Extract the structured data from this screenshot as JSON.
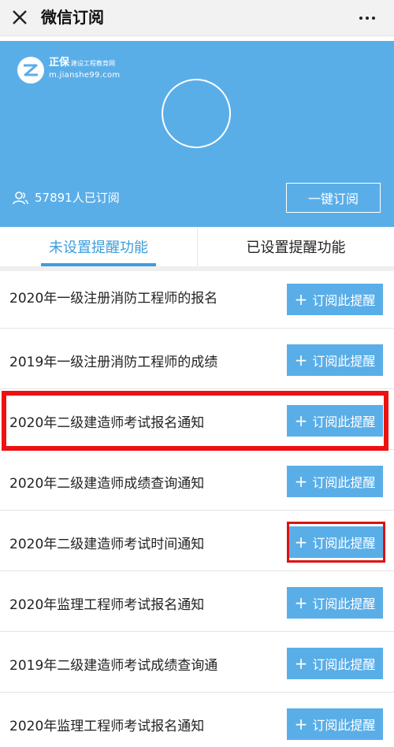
{
  "header": {
    "title": "微信订阅",
    "close_icon": "close-icon",
    "more_icon": "more-dots-icon"
  },
  "hero": {
    "logo_name": "正保",
    "logo_tagline": "建设工程教育网",
    "logo_url": "m.jianshe99.com",
    "subscriber_text": "57891人已订阅",
    "one_click_label": "一键订阅",
    "background_color": "#5aaee8"
  },
  "tabs": [
    {
      "label": "未设置提醒功能",
      "active": true
    },
    {
      "label": "已设置提醒功能",
      "active": false
    }
  ],
  "subscribe_button_label": "订阅此提醒",
  "items": [
    {
      "title": "2020年一级注册消防工程师的报名"
    },
    {
      "title": "2019年一级注册消防工程师的成绩"
    },
    {
      "title": "2020年二级建造师考试报名通知"
    },
    {
      "title": "2020年二级建造师成绩查询通知"
    },
    {
      "title": "2020年二级建造师考试时间通知"
    },
    {
      "title": "2020年监理工程师考试报名通知"
    },
    {
      "title": "2019年二级建造师考试成绩查询通"
    },
    {
      "title": "2020年监理工程师考试报名通知"
    }
  ],
  "colors": {
    "accent": "#3e9ddc",
    "button": "#5aaee8",
    "highlight": "#ee1111"
  }
}
